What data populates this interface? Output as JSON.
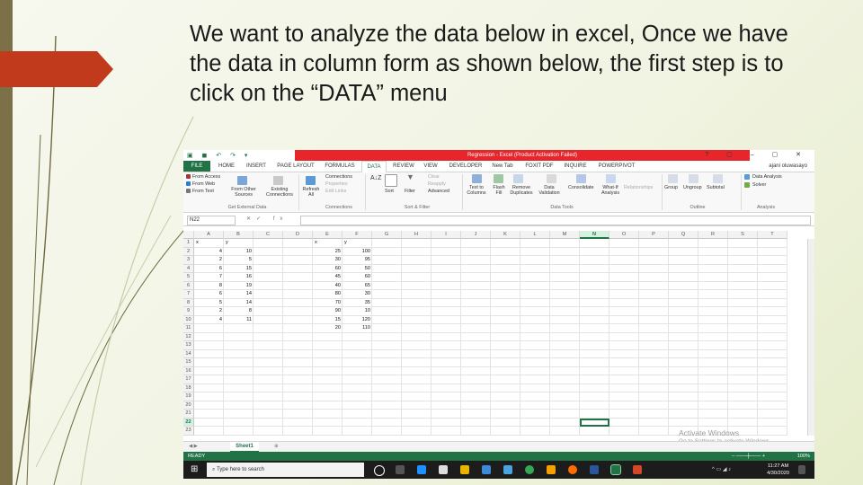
{
  "slide": {
    "text": "We want to analyze the data below in excel, Once we have the data in column form as shown below, the first step is to click on the “DATA” menu"
  },
  "excel": {
    "title": "Regression - Excel (Product Activation Failed)",
    "user": "ajani oluwasayo",
    "tabs": [
      "FILE",
      "HOME",
      "INSERT",
      "PAGE LAYOUT",
      "FORMULAS",
      "DATA",
      "REVIEW",
      "VIEW",
      "DEVELOPER",
      "New Tab",
      "FOXIT PDF",
      "INQUIRE",
      "POWERPIVOT"
    ],
    "active_tab": "DATA",
    "ribbon": {
      "external": [
        "From Access",
        "From Web",
        "From Text",
        "From Other Sources",
        "Existing Connections"
      ],
      "refresh_all": "Refresh All",
      "connections": [
        "Connections",
        "Properties",
        "Edit Links"
      ],
      "sort": "Sort",
      "filter": "Filter",
      "filter_opts": [
        "Clear",
        "Reapply",
        "Advanced"
      ],
      "tools": [
        "Text to Columns",
        "Flash Fill",
        "Remove Duplicates",
        "Data Validation",
        "Consolidate",
        "What-If Analysis",
        "Relationships"
      ],
      "outline": [
        "Group",
        "Ungroup",
        "Subtotal"
      ],
      "analysis": [
        "Data Analysis",
        "Solver"
      ],
      "groups": [
        "Get External Data",
        "Connections",
        "Sort & Filter",
        "Data Tools",
        "Outline",
        "Analysis"
      ]
    },
    "name_box": "N22",
    "columns": [
      "A",
      "B",
      "C",
      "D",
      "E",
      "F",
      "G",
      "H",
      "I",
      "J",
      "K",
      "L",
      "M",
      "N",
      "O",
      "P",
      "Q",
      "R",
      "S",
      "T"
    ],
    "selected_column": "N",
    "selected_row": "22",
    "rows": [
      "1",
      "2",
      "3",
      "4",
      "5",
      "6",
      "7",
      "8",
      "9",
      "10",
      "11",
      "12",
      "13",
      "14",
      "15",
      "16",
      "17",
      "18",
      "19",
      "20",
      "21",
      "22",
      "23"
    ],
    "set1": {
      "x_label": "x",
      "y_label": "y",
      "x": [
        "4",
        "2",
        "6",
        "7",
        "8",
        "6",
        "5",
        "2",
        "4"
      ],
      "y": [
        "10",
        "5",
        "15",
        "16",
        "19",
        "14",
        "14",
        "8",
        "11"
      ]
    },
    "set2": {
      "x_label": "x",
      "y_label": "y",
      "x": [
        "25",
        "30",
        "60",
        "45",
        "40",
        "80",
        "70",
        "90",
        "15",
        "20"
      ],
      "y": [
        "100",
        "95",
        "50",
        "60",
        "65",
        "30",
        "35",
        "10",
        "120",
        "110"
      ]
    },
    "sheet_tab": "Sheet1",
    "watermark_title": "Activate Windows",
    "watermark_sub": "Go to Settings to activate Windows.",
    "status": "READY",
    "zoom": "100%",
    "search_placeholder": "Type here to search",
    "time": "11:27 AM",
    "date": "4/30/2020",
    "brand_color": "#217346",
    "title_color": "#e6262a"
  }
}
